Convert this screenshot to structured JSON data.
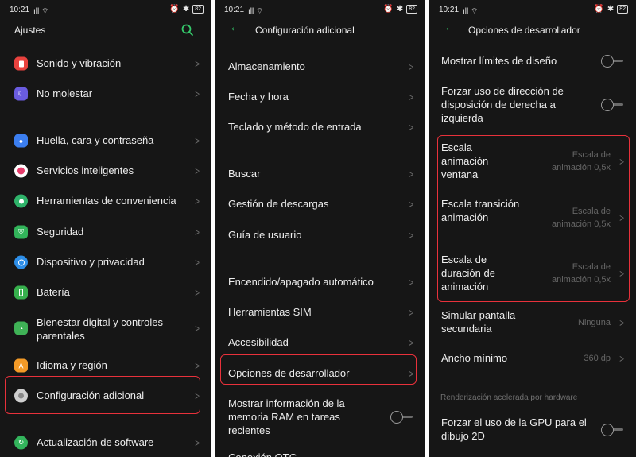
{
  "status": {
    "time": "10:21",
    "signal": "ıll ⌔",
    "battery": "82",
    "alarm": "⏰",
    "bluetooth": "✱"
  },
  "panel1": {
    "title": "Ajustes",
    "items": [
      {
        "label": "Sonido y vibración",
        "icon": "sound-icon",
        "color": "#e8423e"
      },
      {
        "label": "No molestar",
        "icon": "moon-icon",
        "color": "#6a5ce0"
      },
      {
        "label": "Huella, cara y contraseña",
        "icon": "fingerprint-icon",
        "color": "#3b7ef0"
      },
      {
        "label": "Servicios inteligentes",
        "icon": "smart-services-icon",
        "color": "#e63c6b"
      },
      {
        "label": "Herramientas de conveniencia",
        "icon": "convenience-tools-icon",
        "color": "#2fb36a"
      },
      {
        "label": "Seguridad",
        "icon": "shield-icon",
        "color": "#32b45a"
      },
      {
        "label": "Dispositivo y privacidad",
        "icon": "privacy-icon",
        "color": "#2d8ee8"
      },
      {
        "label": "Batería",
        "icon": "battery-icon",
        "color": "#37b04d"
      },
      {
        "label": "Bienestar digital y controles parentales",
        "icon": "wellbeing-icon",
        "color": "#3fb256"
      },
      {
        "label": "Idioma y región",
        "icon": "language-icon",
        "color": "#f39a27"
      },
      {
        "label": "Configuración adicional",
        "icon": "gear-icon",
        "color": "#9a9a9a"
      },
      {
        "label": "Actualización de software",
        "icon": "update-icon",
        "color": "#33b45c"
      }
    ]
  },
  "panel2": {
    "title": "Configuración adicional",
    "items": [
      {
        "label": "Almacenamiento"
      },
      {
        "label": "Fecha y hora"
      },
      {
        "label": "Teclado y método de entrada"
      },
      {
        "label": "Buscar"
      },
      {
        "label": "Gestión de descargas"
      },
      {
        "label": "Guía de usuario"
      },
      {
        "label": "Encendido/apagado automático"
      },
      {
        "label": "Herramientas SIM"
      },
      {
        "label": "Accesibilidad"
      },
      {
        "label": "Opciones de desarrollador"
      },
      {
        "label": "Mostrar información de la memoria RAM en tareas recientes"
      },
      {
        "label": "Conexión OTG"
      }
    ]
  },
  "panel3": {
    "title": "Opciones de desarrollador",
    "items": [
      {
        "label": "Mostrar límites de diseño"
      },
      {
        "label": "Forzar uso de dirección de disposición de derecha a izquierda"
      },
      {
        "label": "Escala animación ventana",
        "value": "Escala de animación 0,5x"
      },
      {
        "label": "Escala transición animación",
        "value": "Escala de animación 0,5x"
      },
      {
        "label": "Escala de duración de animación",
        "value": "Escala de animación 0,5x"
      },
      {
        "label": "Simular pantalla secundaria",
        "value": "Ninguna"
      },
      {
        "label": "Ancho mínimo",
        "value": "360 dp"
      },
      {
        "label": "Forzar el uso de la GPU para el dibujo 2D"
      }
    ],
    "section": "Renderización acelerada por hardware"
  },
  "highlight_color": "#e8313b",
  "accent_color": "#35c96b"
}
